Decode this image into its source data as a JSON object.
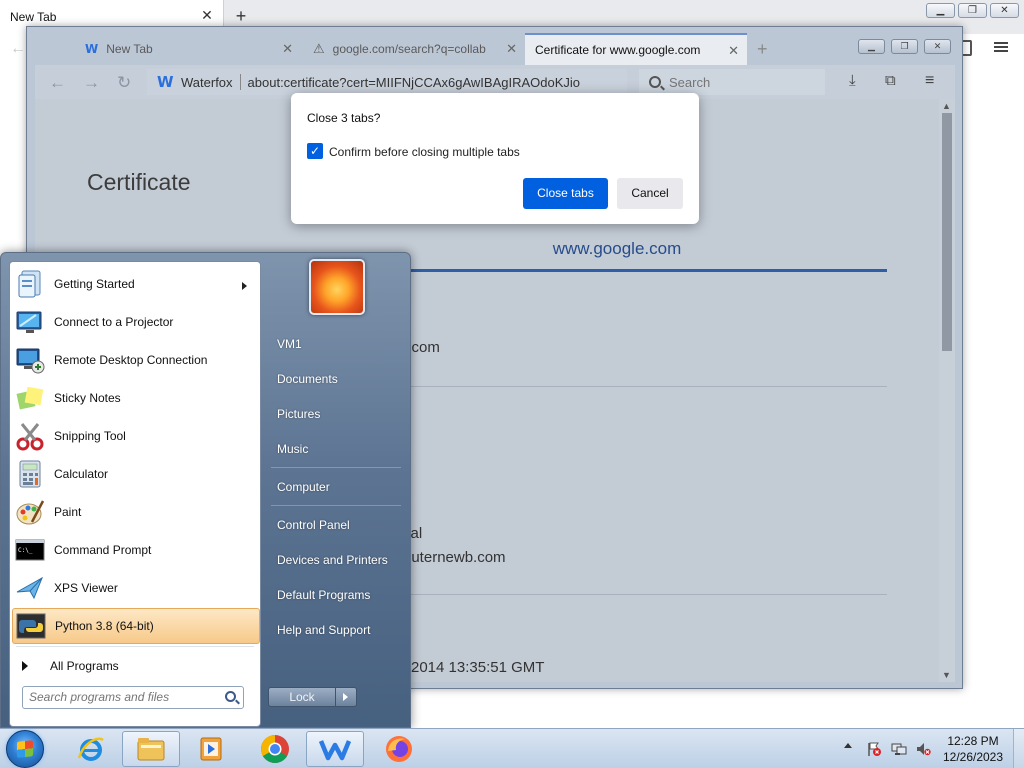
{
  "back_browser": {
    "tab_title": "New Tab"
  },
  "browser": {
    "tabs": [
      {
        "title": "New Tab"
      },
      {
        "title": "google.com/search?q=collab"
      },
      {
        "title": "Certificate for www.google.com"
      }
    ],
    "url_brand": "Waterfox",
    "url": "about:certificate?cert=MIIFNjCCAx6gAwIBAgIRAOdoKJio",
    "search_placeholder": "Search",
    "page": {
      "heading": "Certificate",
      "selected_cert_tab": "www.google.com",
      "rows": [
        "e.com",
        "cal",
        "outernewb.com",
        "2014 13:35:51 GMT"
      ]
    }
  },
  "dialog": {
    "title": "Close 3 tabs?",
    "checkbox_label": "Confirm before closing multiple tabs",
    "checkbox_checked": true,
    "ok_label": "Close tabs",
    "cancel_label": "Cancel"
  },
  "start_menu": {
    "programs": [
      {
        "label": "Getting Started",
        "icon": "getting-started-icon"
      },
      {
        "label": "Connect to a Projector",
        "icon": "projector-icon"
      },
      {
        "label": "Remote Desktop Connection",
        "icon": "remote-desktop-icon"
      },
      {
        "label": "Sticky Notes",
        "icon": "sticky-notes-icon"
      },
      {
        "label": "Snipping Tool",
        "icon": "snipping-tool-icon"
      },
      {
        "label": "Calculator",
        "icon": "calculator-icon"
      },
      {
        "label": "Paint",
        "icon": "paint-icon"
      },
      {
        "label": "Command Prompt",
        "icon": "command-prompt-icon"
      },
      {
        "label": "XPS Viewer",
        "icon": "xps-viewer-icon"
      },
      {
        "label": "Python 3.8 (64-bit)",
        "icon": "python-icon"
      }
    ],
    "all_programs": "All Programs",
    "search_placeholder": "Search programs and files",
    "right_links": [
      "VM1",
      "Documents",
      "Pictures",
      "Music",
      "Computer",
      "Control Panel",
      "Devices and Printers",
      "Default Programs",
      "Help and Support"
    ],
    "shutdown_label": "Lock"
  },
  "taskbar": {
    "pinned": [
      "internet-explorer-icon",
      "file-explorer-icon",
      "media-player-icon",
      "chrome-icon",
      "waterfox-icon",
      "firefox-icon"
    ],
    "clock_time": "12:28 PM",
    "clock_date": "12/26/2023"
  },
  "colors": {
    "accent": "#0060df",
    "cert_tab_underline": "#2f5ea6",
    "start_menu_highlight": "#f7c98a"
  }
}
